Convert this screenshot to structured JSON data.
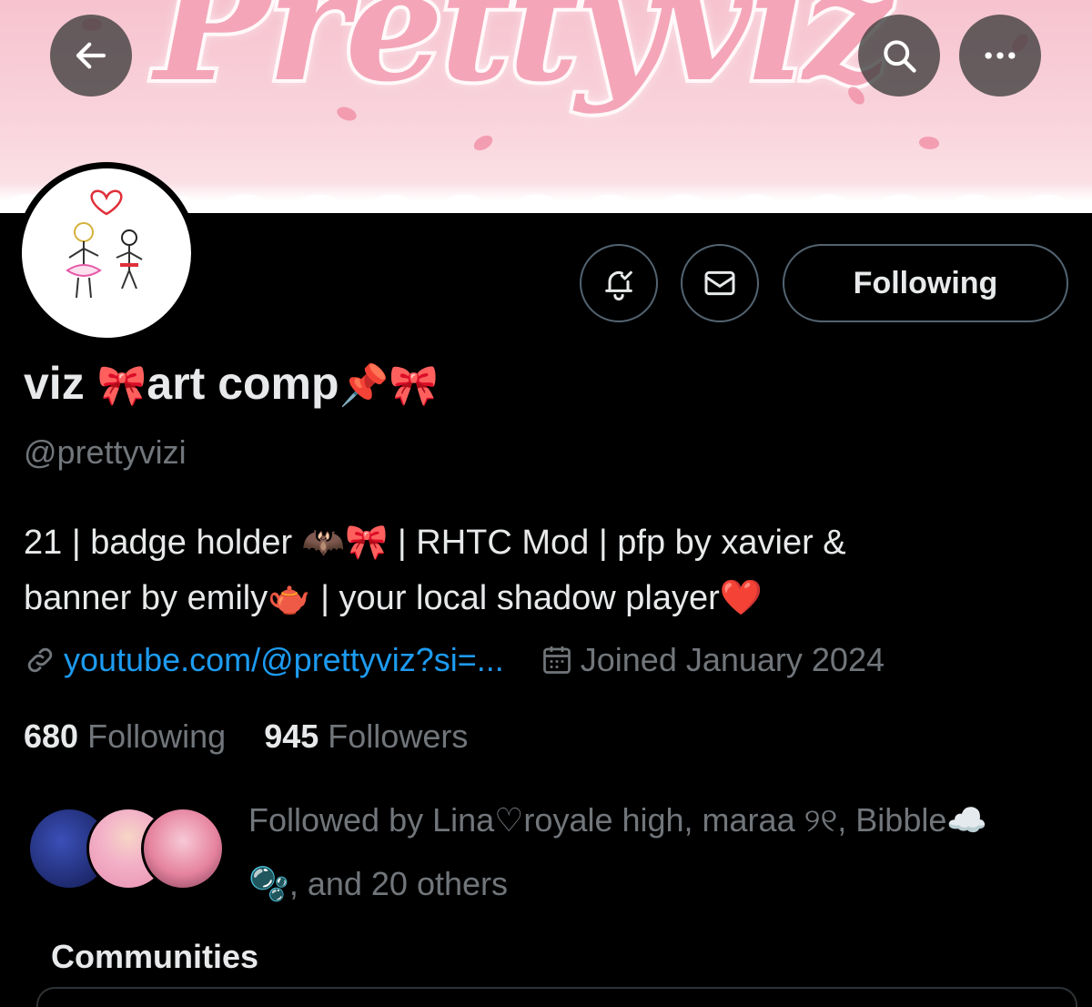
{
  "header": {
    "banner_text": "Prettyviz",
    "back_icon": "arrow-left-icon",
    "search_icon": "search-icon",
    "more_icon": "more-horizontal-icon"
  },
  "profile": {
    "name_part1": "viz ",
    "name_emoji1": "🎀",
    "name_part2": "art comp",
    "name_emoji2": "📌🎀",
    "handle": "@prettyvizi",
    "bio_line1": "21 | badge holder 🦇🎀 | RHTC Mod | pfp by xavier &",
    "bio_line2": "banner by emily🫖 | your local shadow player❤️",
    "link": "youtube.com/@prettyviz?si=...",
    "joined": "Joined January 2024"
  },
  "actions": {
    "notify_icon": "bell-check-icon",
    "message_icon": "envelope-icon",
    "follow_label": "Following"
  },
  "stats": {
    "following_count": "680",
    "following_label": "Following",
    "followers_count": "945",
    "followers_label": "Followers"
  },
  "followed_by": {
    "line1": "Followed by Lina♡royale high, maraa ୨୧, Bibble☁️",
    "line2": "🫧, and 20 others"
  },
  "sections": {
    "communities": "Communities"
  },
  "colors": {
    "background": "#000000",
    "text_primary": "#e7e9ea",
    "text_secondary": "#71767b",
    "link": "#1d9bf0",
    "border": "#536471",
    "banner_pink": "#f6c3cf"
  }
}
